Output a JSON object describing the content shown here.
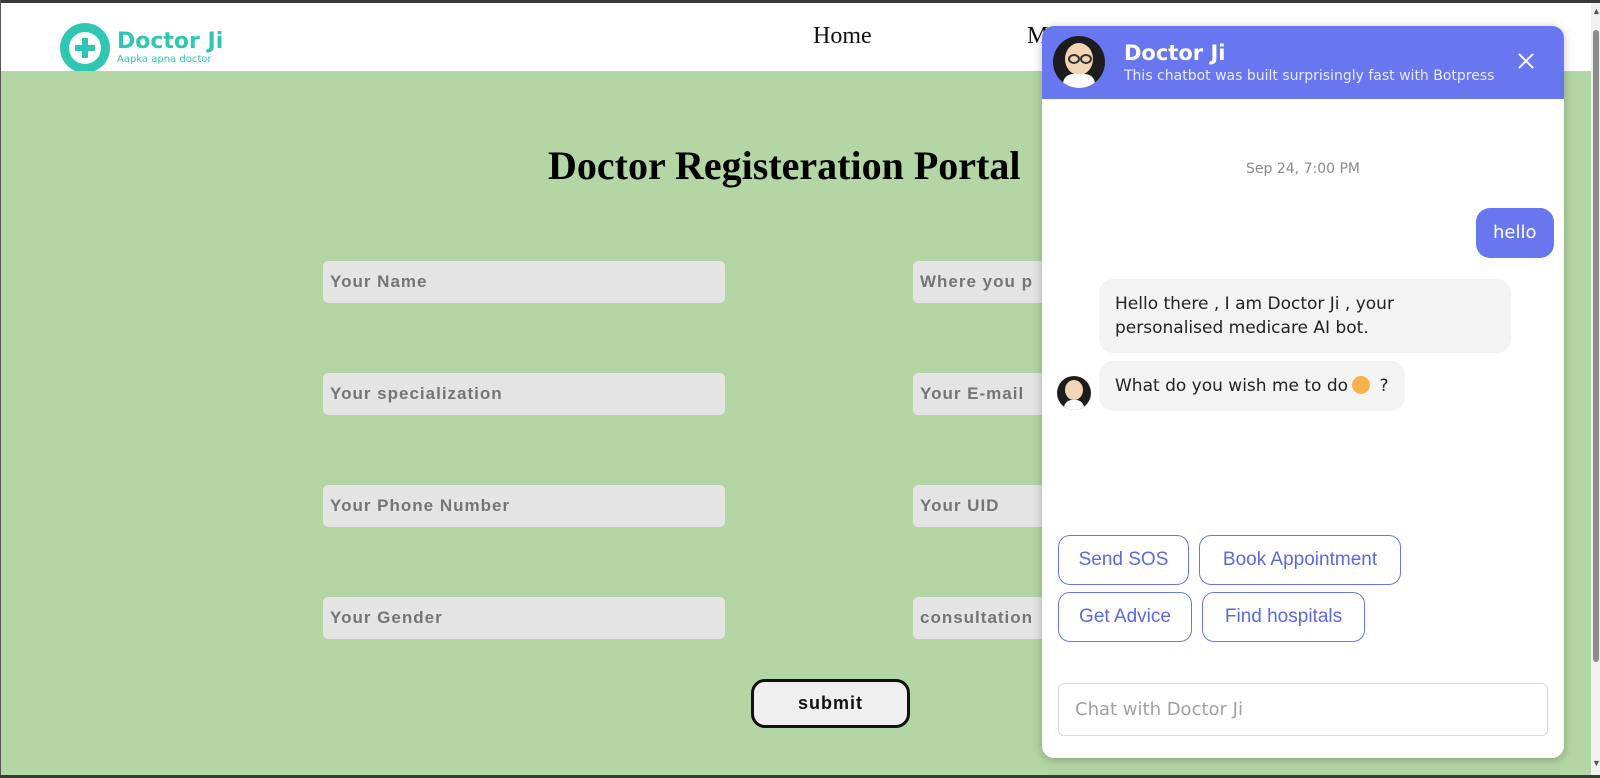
{
  "navbar": {
    "brand_name": "Doctor Ji",
    "brand_tagline": "Aapka apna doctor",
    "links": [
      "Home",
      "M"
    ]
  },
  "form": {
    "title": "Doctor Registeration Portal",
    "fields": [
      {
        "placeholder": "Your Name"
      },
      {
        "placeholder": "Where you p"
      },
      {
        "placeholder": "Your specialization"
      },
      {
        "placeholder": "Your E-mail"
      },
      {
        "placeholder": "Your Phone Number"
      },
      {
        "placeholder": "Your UID"
      },
      {
        "placeholder": "Your Gender"
      },
      {
        "placeholder": "consultation"
      }
    ],
    "submit_label": "submit"
  },
  "chatbot": {
    "title": "Doctor Ji",
    "subtitle": "This chatbot was built surprisingly fast with Botpress",
    "timestamp": "Sep 24, 7:00 PM",
    "user_message": "hello",
    "bot_message_1": "Hello there , I am Doctor Ji , your personalised medicare AI bot.",
    "bot_message_2_before": "What do you wish me to do",
    "bot_message_2_after": " ?",
    "quick_replies": [
      "Send SOS",
      "Book Appointment",
      "Get Advice",
      "Find hospitals"
    ],
    "input_placeholder": "Chat with Doctor Ji"
  },
  "colors": {
    "brand": "#2fc6b2",
    "page_background": "#b4d6a4",
    "chat_accent": "#6876f0"
  },
  "icons": [
    "logo-plus-icon",
    "close-icon",
    "bot-avatar",
    "emoji-icon",
    "scroll-up-arrow-icon",
    "scroll-down-arrow-icon"
  ]
}
